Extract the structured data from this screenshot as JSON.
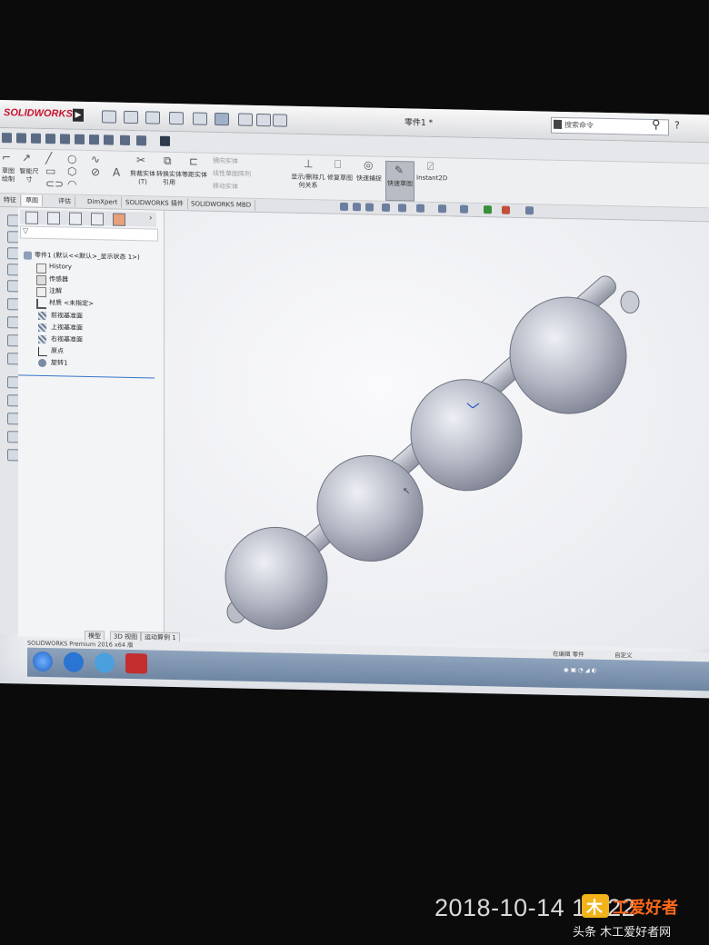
{
  "app": {
    "logo_text": "SOLIDWORKS",
    "doc_title": "零件1 *",
    "search_placeholder": "搜索命令",
    "help_label": "?"
  },
  "ribbon": {
    "sketch_label": "草图绘制",
    "smart_dim_label": "智能尺寸",
    "trim_label": "剪裁实体(T)",
    "convert_label": "转换实体引用",
    "offset_label": "等距实体",
    "mirror_label": "镜向实体",
    "linear_pattern_label": "线性草图阵列",
    "move_label": "移动实体",
    "display_delete_label": "显示/删除几何关系",
    "repair_label": "修复草图",
    "quick_snap_label": "快速捕捉",
    "rapid_sketch_label": "快速草图",
    "instant2d_label": "Instant2D"
  },
  "tabs": [
    "特征",
    "草图",
    "评估",
    "DimXpert",
    "SOLIDWORKS 插件",
    "SOLIDWORKS MBD"
  ],
  "active_tab": "草图",
  "tree": {
    "root": "零件1 (默认<<默认>_显示状态 1>)",
    "items": [
      {
        "label": "History",
        "icon": "history-icon"
      },
      {
        "label": "传感器",
        "icon": "sensor-icon"
      },
      {
        "label": "注解",
        "icon": "annotation-icon"
      },
      {
        "label": "材质 <未指定>",
        "icon": "material-icon"
      },
      {
        "label": "前视基准面",
        "icon": "plane-icon"
      },
      {
        "label": "上视基准面",
        "icon": "plane-icon"
      },
      {
        "label": "右视基准面",
        "icon": "plane-icon"
      },
      {
        "label": "原点",
        "icon": "origin-icon"
      },
      {
        "label": "旋转1",
        "icon": "revolve-icon"
      }
    ]
  },
  "bottom_tabs": [
    "模型",
    "3D 视图",
    "运动算例 1"
  ],
  "status": {
    "left": "SOLIDWORKS Premium 2016 x64 版",
    "editing": "在编辑 零件",
    "custom": "自定义"
  },
  "photo_overlay": {
    "timestamp": "2018-10-14 19:22",
    "watermark_brand": "木工爱好者",
    "watermark_source": "头条 木工爱好者网"
  }
}
